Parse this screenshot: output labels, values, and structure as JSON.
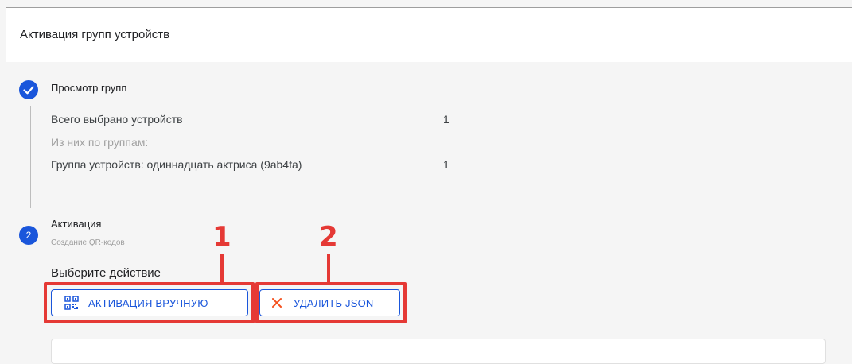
{
  "dialog": {
    "title": "Активация групп устройств"
  },
  "step1": {
    "title": "Просмотр групп",
    "summary": {
      "total_label": "Всего выбрано устройств",
      "total_value": "1",
      "by_groups_label": "Из них по группам:",
      "groups": [
        {
          "label": "Группа устройств: одиннадцать актриса (9ab4fa)",
          "value": "1"
        }
      ]
    }
  },
  "step2": {
    "number": "2",
    "title": "Активация",
    "subtitle": "Создание QR-кодов",
    "choose_label": "Выберите действие",
    "buttons": {
      "manual_label": "АКТИВАЦИЯ ВРУЧНУЮ",
      "delete_json_label": "УДАЛИТЬ JSON"
    }
  },
  "annotations": {
    "callout_1": "1",
    "callout_2": "2"
  },
  "colors": {
    "accent": "#1a56db",
    "annotation_red": "#e53935",
    "delete_icon": "#f4511e"
  }
}
